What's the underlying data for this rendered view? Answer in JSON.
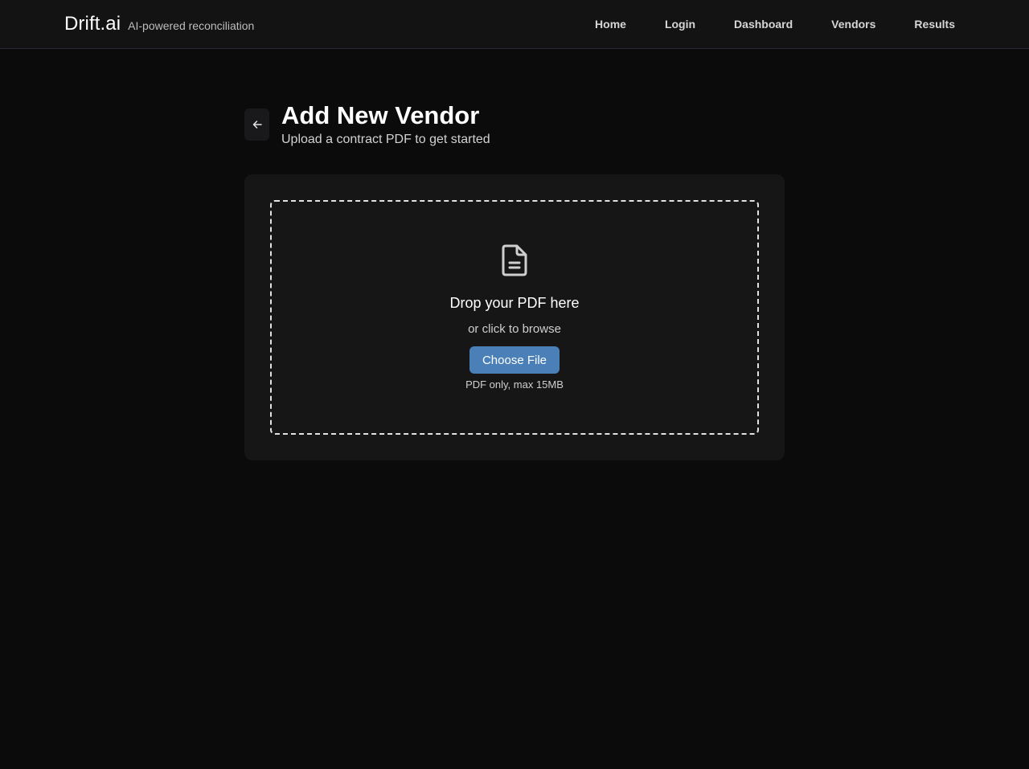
{
  "header": {
    "brand": "Drift.ai",
    "tagline": "AI-powered reconciliation",
    "nav": [
      {
        "label": "Home"
      },
      {
        "label": "Login"
      },
      {
        "label": "Dashboard"
      },
      {
        "label": "Vendors"
      },
      {
        "label": "Results"
      }
    ]
  },
  "page": {
    "title": "Add New Vendor",
    "subtitle": "Upload a contract PDF to get started",
    "back_icon": "arrow-left-icon"
  },
  "upload": {
    "icon": "document-icon",
    "title": "Drop your PDF here",
    "subtitle": "or click to browse",
    "button_label": "Choose File",
    "hint": "PDF only, max 15MB"
  },
  "colors": {
    "background": "#0b0b0c",
    "topbar": "#131314",
    "card": "#161617",
    "accent_button": "#4a80b7"
  }
}
